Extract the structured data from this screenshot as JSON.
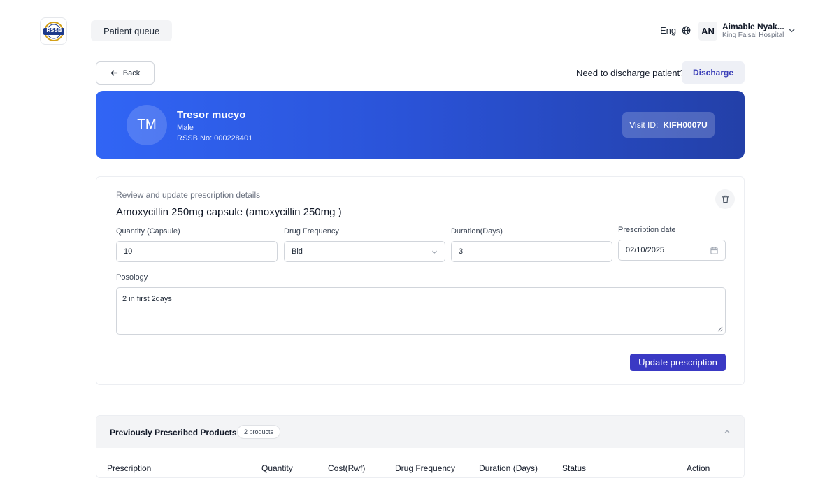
{
  "header": {
    "logo_text": "RSSB",
    "queue_label": "Patient queue",
    "language": "Eng",
    "user": {
      "initials": "AN",
      "name": "Aimable Nyak...",
      "hospital": "King Faisal Hospital"
    }
  },
  "actions": {
    "back_label": "Back",
    "discharge_question": "Need to discharge patient?",
    "discharge_label": "Discharge"
  },
  "patient": {
    "initials": "TM",
    "name": "Tresor mucyo",
    "gender": "Male",
    "rssb_no": "RSSB No: 000228401",
    "visit_label": "Visit ID:",
    "visit_id": "KIFH0007U"
  },
  "prescription": {
    "subtitle": "Review and update prescription details",
    "drug": "Amoxycillin 250mg capsule (amoxycillin 250mg )",
    "quantity_label": "Quantity (Capsule)",
    "quantity_value": "10",
    "frequency_label": "Drug Frequency",
    "frequency_value": "Bid",
    "duration_label": "Duration(Days)",
    "duration_value": "3",
    "date_label": "Prescription date",
    "date_value": "02/10/2025",
    "posology_label": "Posology",
    "posology_value": "2 in first 2days",
    "update_label": "Update prescription"
  },
  "previous": {
    "title": "Previously Prescribed Products",
    "badge": "2 products",
    "columns": [
      "Prescription",
      "Quantity",
      "Cost(Rwf)",
      "Drug Frequency",
      "Duration (Days)",
      "Status",
      "Action"
    ]
  },
  "colors": {
    "banner_start": "#3165f5",
    "banner_end": "#2340a8",
    "primary_button": "#3a39c4",
    "discharge_text": "#3b3fb8"
  }
}
